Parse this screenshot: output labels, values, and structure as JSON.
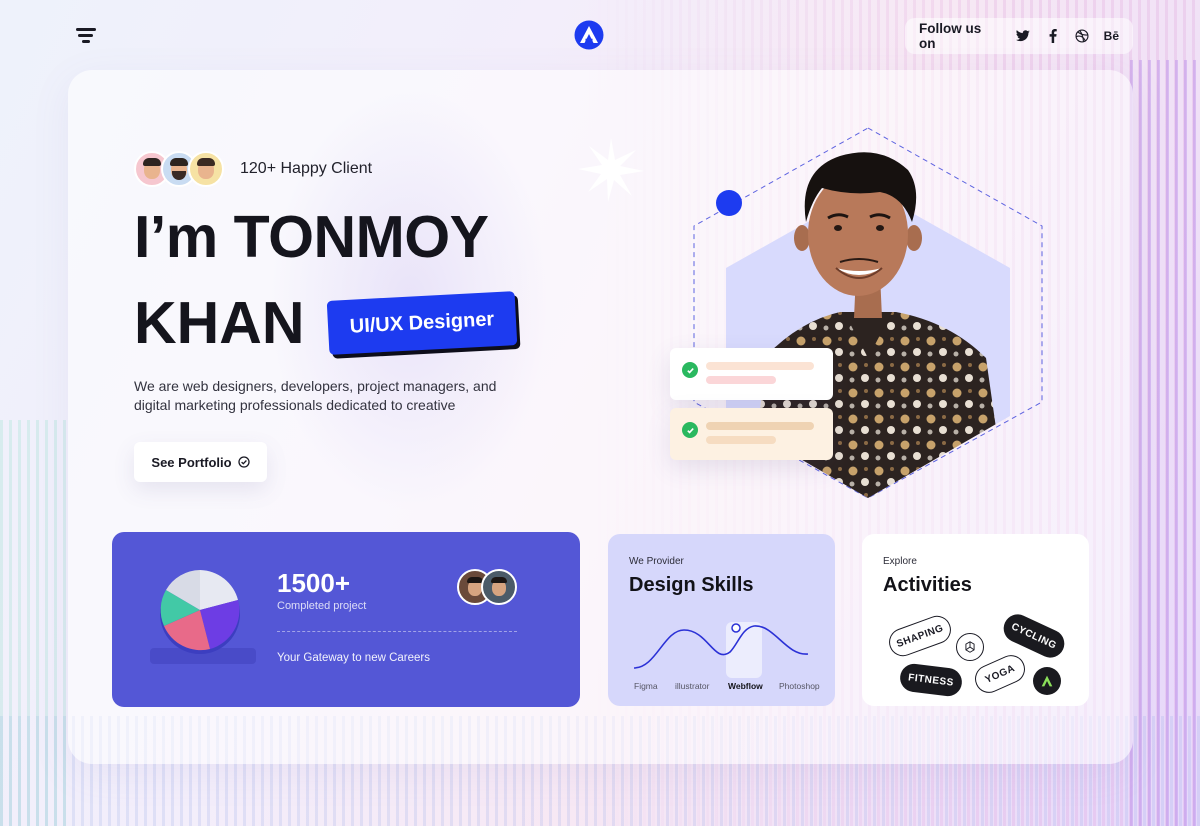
{
  "header": {
    "menu_icon": "menu-icon",
    "logo_icon": "brand-logo-icon",
    "follow_label": "Follow us on",
    "social": [
      {
        "name": "twitter-icon"
      },
      {
        "name": "facebook-icon"
      },
      {
        "name": "dribbble-icon"
      },
      {
        "name": "behance-icon",
        "text": "Bē"
      }
    ]
  },
  "hero": {
    "happy_clients": "120+ Happy Client",
    "title_line1": "I’m TONMOY",
    "title_line2": "KHAN",
    "role": "UI/UX Designer",
    "description": "We are web designers, developers, project managers, and digital marketing professionals dedicated to creative",
    "cta": "See Portfolio",
    "accent": "#1d3bf0"
  },
  "stats": {
    "number": "1500+",
    "label": "Completed project",
    "tagline": "Your Gateway to new Careers",
    "bg": "#5457d6"
  },
  "skills": {
    "kicker": "We Provider",
    "title": "Design Skills",
    "tools": [
      "Figma",
      "illustrator",
      "Webflow",
      "Photoshop"
    ],
    "active_tool": "Webflow"
  },
  "activities": {
    "kicker": "Explore",
    "title": "Activities",
    "pills": [
      "SHAPING",
      "CYCLING",
      "FITNESS",
      "YOGA"
    ]
  }
}
